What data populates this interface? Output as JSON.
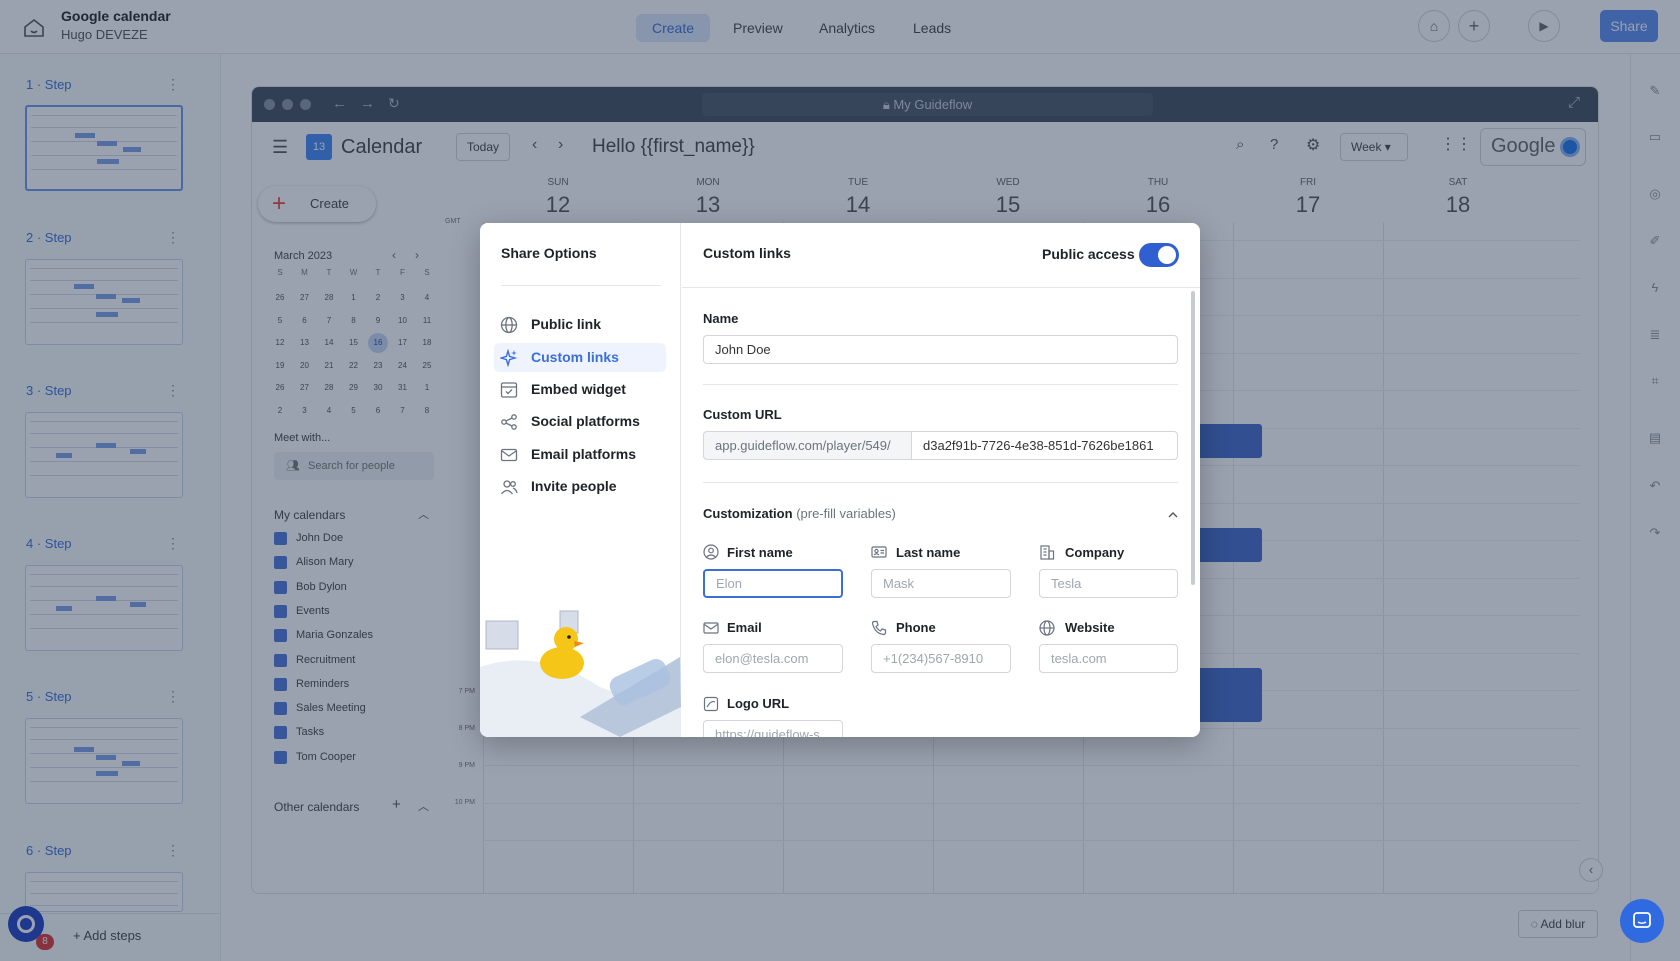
{
  "header": {
    "app_title": "Google calendar",
    "app_subtitle": "Hugo DEVEZE",
    "tabs": [
      "Create",
      "Preview",
      "Analytics",
      "Leads"
    ],
    "active_tab": "Create",
    "share_label": "Share"
  },
  "steps": [
    {
      "label": "1 · Step"
    },
    {
      "label": "2 · Step"
    },
    {
      "label": "3 · Step"
    },
    {
      "label": "4 · Step"
    },
    {
      "label": "5 · Step"
    },
    {
      "label": "6 · Step"
    }
  ],
  "add_steps_label": "+ Add steps",
  "notification_count": "8",
  "browser": {
    "url_text": "My Guideflow"
  },
  "calendar": {
    "app_name": "Calendar",
    "today_label": "Today",
    "heading": "Hello {{first_name}}",
    "view_label": "Week",
    "brand": "Google",
    "create_label": "Create",
    "month_label": "March 2023",
    "weekday_initials": [
      "S",
      "M",
      "T",
      "W",
      "T",
      "F",
      "S"
    ],
    "mini_days": [
      [
        "26",
        "27",
        "28",
        "1",
        "2",
        "3",
        "4"
      ],
      [
        "5",
        "6",
        "7",
        "8",
        "9",
        "10",
        "11"
      ],
      [
        "12",
        "13",
        "14",
        "15",
        "16",
        "17",
        "18"
      ],
      [
        "19",
        "20",
        "21",
        "22",
        "23",
        "24",
        "25"
      ],
      [
        "26",
        "27",
        "28",
        "29",
        "30",
        "31",
        "1"
      ],
      [
        "2",
        "3",
        "4",
        "5",
        "6",
        "7",
        "8"
      ]
    ],
    "meet_with": "Meet with...",
    "search_people": "Search for people",
    "my_calendars_label": "My calendars",
    "my_calendars": [
      "John Doe",
      "Alison Mary",
      "Bob Dylon",
      "Events",
      "Maria Gonzales",
      "Recruitment",
      "Reminders",
      "Sales Meeting",
      "Tasks",
      "Tom Cooper"
    ],
    "other_calendars_label": "Other calendars",
    "days": [
      {
        "name": "SUN",
        "num": "12"
      },
      {
        "name": "MON",
        "num": "13"
      },
      {
        "name": "TUE",
        "num": "14"
      },
      {
        "name": "WED",
        "num": "15"
      },
      {
        "name": "THU",
        "num": "16"
      },
      {
        "name": "FRI",
        "num": "17"
      },
      {
        "name": "SAT",
        "num": "18"
      }
    ],
    "timezone_label": "GMT",
    "hours": [
      "7 PM",
      "8 PM",
      "9 PM",
      "10 PM"
    ]
  },
  "add_blur_label": "Add blur",
  "modal": {
    "side_title": "Share Options",
    "menu": [
      {
        "label": "Public link",
        "icon": "globe-icon"
      },
      {
        "label": "Custom links",
        "icon": "sparkle-icon"
      },
      {
        "label": "Embed widget",
        "icon": "embed-icon"
      },
      {
        "label": "Social platforms",
        "icon": "share-nodes-icon"
      },
      {
        "label": "Email platforms",
        "icon": "mail-icon"
      },
      {
        "label": "Invite people",
        "icon": "users-icon"
      }
    ],
    "active_menu": "Custom links",
    "main_title": "Custom links",
    "public_access_label": "Public access",
    "public_access_on": true,
    "name_label": "Name",
    "name_value": "John Doe",
    "custom_url_label": "Custom URL",
    "url_prefix": "app.guideflow.com/player/549/",
    "url_value": "d3a2f91b-7726-4e38-851d-7626be1861",
    "customization_label": "Customization",
    "customization_hint": "(pre-fill variables)",
    "fields": [
      {
        "label": "First name",
        "placeholder": "Elon",
        "icon": "user-circle-icon"
      },
      {
        "label": "Last name",
        "placeholder": "Mask",
        "icon": "id-card-icon"
      },
      {
        "label": "Company",
        "placeholder": "Tesla",
        "icon": "building-icon"
      },
      {
        "label": "Email",
        "placeholder": "elon@tesla.com",
        "icon": "mail-icon"
      },
      {
        "label": "Phone",
        "placeholder": "+1(234)567-8910",
        "icon": "phone-icon"
      },
      {
        "label": "Website",
        "placeholder": "tesla.com",
        "icon": "globe-icon"
      },
      {
        "label": "Logo URL",
        "placeholder": "https://guideflow-s",
        "icon": "image-icon"
      }
    ]
  },
  "colors": {
    "accent": "#3b6fd8",
    "toggle": "#2f5fd0",
    "overlay": "#1e304e"
  }
}
